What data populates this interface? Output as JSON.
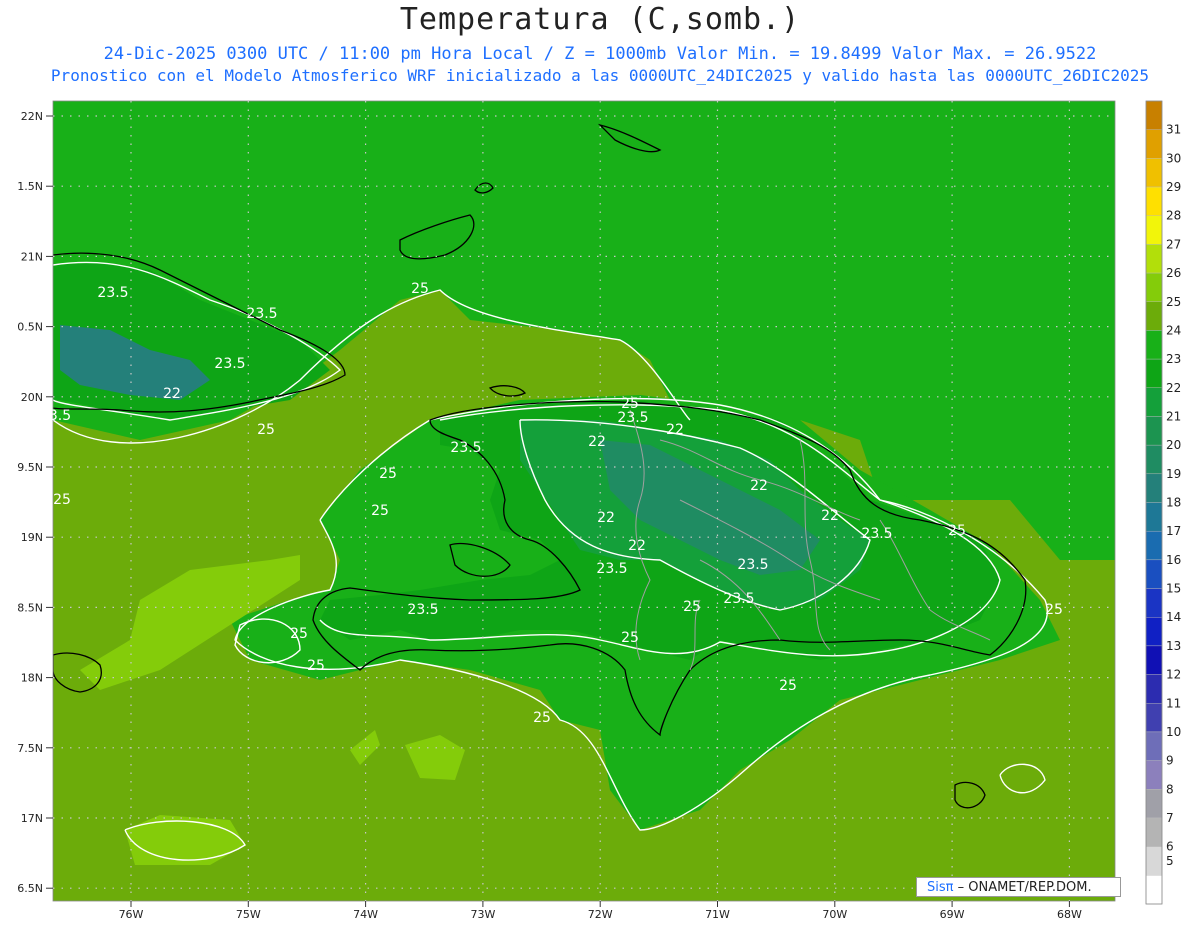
{
  "header": {
    "title": "Temperatura (C,somb.)",
    "subtitle_line1": "24-Dic-2025 0300 UTC / 11:00 pm Hora Local / Z = 1000mb  Valor Min. = 19.8499  Valor Max. = 26.9522",
    "subtitle_line2": "Pronostico con el Modelo Atmosferico WRF inicializado a las 0000UTC_24DIC2025 y valido hasta las  0000UTC_26DIC2025"
  },
  "map": {
    "lat_labels": [
      "22N",
      "1.5N",
      "21N",
      "0.5N",
      "20N",
      "9.5N",
      "19N",
      "8.5N",
      "18N",
      "7.5N",
      "17N",
      "6.5N"
    ],
    "lon_labels": [
      "76W",
      "75W",
      "74W",
      "73W",
      "72W",
      "71W",
      "70W",
      "69W",
      "68W"
    ],
    "contour_labels": [
      "23.5",
      "23.5",
      "23.5",
      "22",
      "3.5",
      "25",
      "25",
      "25",
      "25",
      "23.5",
      "22",
      "22",
      "23.5",
      "25",
      "25",
      "22",
      "22",
      "22",
      "22",
      "23.5",
      "25",
      "23.5",
      "23.5",
      "23.5",
      "25",
      "25",
      "25",
      "25",
      "23.5",
      "25",
      "25",
      "25"
    ],
    "colors": {
      "level_22_23": "#14a03a",
      "level_23_24": "#0ea516",
      "level_24_25": "#18b018",
      "level_25_26": "#6cac0a",
      "level_26_27": "#84cc0a",
      "level_20_21": "#1f8c62",
      "level_19_20": "#24807a",
      "contour": "#ffffff",
      "coast": "#000000",
      "province_border": "#a0a0a0"
    }
  },
  "colorbar": {
    "labels": [
      "31",
      "30",
      "29",
      "28",
      "27",
      "26",
      "25",
      "24",
      "23",
      "22",
      "21",
      "20",
      "19",
      "18",
      "17",
      "16",
      "15",
      "14",
      "13",
      "12",
      "11",
      "10",
      "9",
      "8",
      "7",
      "6",
      "5"
    ],
    "colors": [
      "#c88000",
      "#e0a000",
      "#f0c000",
      "#ffe000",
      "#f2f50a",
      "#b2df0a",
      "#84cc0a",
      "#6cac0a",
      "#18b018",
      "#0ea516",
      "#14a03a",
      "#1c9450",
      "#1f8c62",
      "#24807a",
      "#1e7896",
      "#1a6cb0",
      "#1a4fc0",
      "#1a34c4",
      "#1020c4",
      "#1010b4",
      "#2c2cb0",
      "#4040b0",
      "#6e6eb8",
      "#8c80bc",
      "#a0a0a8",
      "#b4b4b4",
      "#d8d8d8",
      "#ffffff"
    ]
  },
  "credit": {
    "logo": "Sisπ",
    "text": " – ONAMET/REP.DOM."
  }
}
